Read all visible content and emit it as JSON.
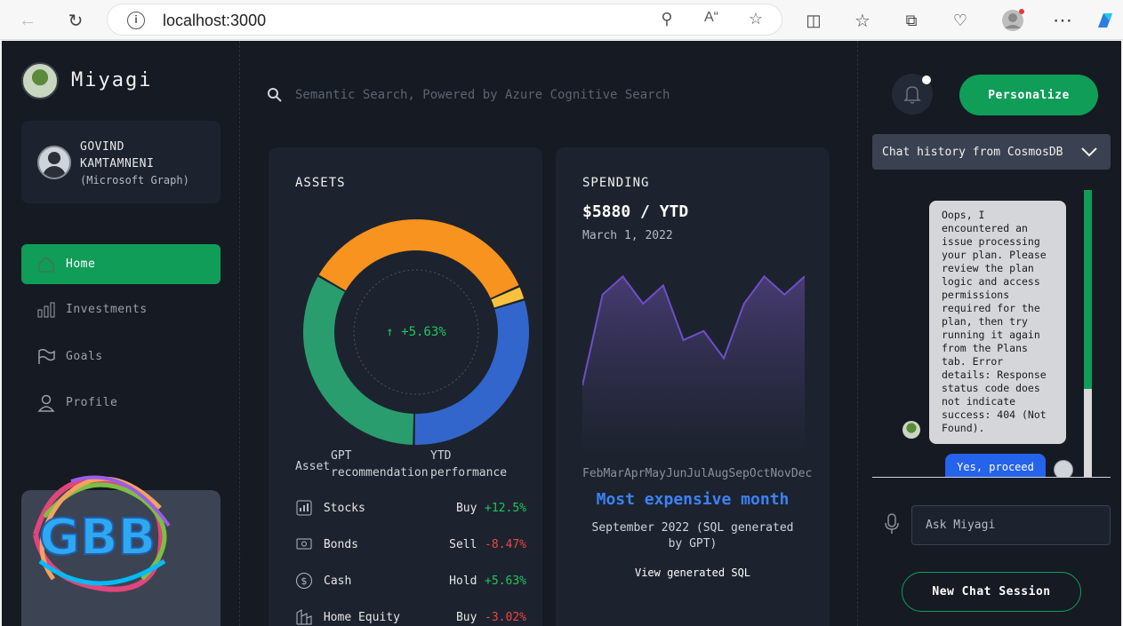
{
  "browser": {
    "url": "localhost:3000"
  },
  "sidebar": {
    "brand": "Miyagi",
    "user": {
      "name": "GOVIND KAMTAMNENI",
      "source": "(Microsoft Graph)"
    },
    "nav": [
      {
        "label": "Home",
        "icon": "home-icon",
        "active": true
      },
      {
        "label": "Investments",
        "icon": "bar-chart-icon",
        "active": false
      },
      {
        "label": "Goals",
        "icon": "flag-icon",
        "active": false
      },
      {
        "label": "Profile",
        "icon": "user-icon",
        "active": false
      }
    ],
    "logo_text": "GBB"
  },
  "main": {
    "search_placeholder": "Semantic Search, Powered by Azure Cognitive Search",
    "assets": {
      "title": "ASSETS",
      "center_label": "↑ +5.63%",
      "columns": [
        "Asset",
        "GPT recommendation",
        "YTD performance"
      ],
      "rows": [
        {
          "name": "Stocks",
          "recommendation": "Buy",
          "performance": "+12.5%",
          "trend": "pos",
          "icon": "stocks-icon"
        },
        {
          "name": "Bonds",
          "recommendation": "Sell",
          "performance": "-8.47%",
          "trend": "neg",
          "icon": "bonds-icon"
        },
        {
          "name": "Cash",
          "recommendation": "Hold",
          "performance": "+5.63%",
          "trend": "pos",
          "icon": "cash-icon"
        },
        {
          "name": "Home Equity",
          "recommendation": "Buy",
          "performance": "-3.02%",
          "trend": "neg",
          "icon": "home-equity-icon"
        }
      ],
      "colors": {
        "orange": "#f7931e",
        "yellow": "#f6c23e",
        "blue": "#3366cc",
        "green": "#2a9d6f"
      }
    },
    "spending": {
      "title": "SPENDING",
      "amount": "$5880 / YTD",
      "date": "March 1, 2022",
      "months": [
        "Feb",
        "Mar",
        "Apr",
        "May",
        "Jun",
        "Jul",
        "Aug",
        "Sep",
        "Oct",
        "Nov",
        "Dec"
      ],
      "most_expensive_label": "Most expensive month",
      "most_expensive_detail": "September 2022 (SQL generated by GPT)",
      "view_sql": "View generated SQL"
    }
  },
  "right": {
    "personalize": "Personalize",
    "chat_history": "Chat history from CosmosDB",
    "bot_message": "Oops, I encountered an issue processing your plan. Please review the plan logic and access permissions required for the plan, then try running it again from the Plans tab. Error details: Response status code does not indicate success: 404 (Not Found).",
    "user_message": "Yes, proceed",
    "ask_placeholder": "Ask Miyagi",
    "new_chat": "New Chat Session"
  },
  "chart_data": [
    {
      "type": "pie",
      "title": "ASSETS",
      "categories": [
        "Stocks",
        "Bonds",
        "Cash",
        "Home Equity"
      ],
      "values": [
        35,
        2,
        30,
        33
      ],
      "colors": [
        "#f7931e",
        "#f6c23e",
        "#3366cc",
        "#2a9d6f"
      ]
    },
    {
      "type": "area",
      "title": "SPENDING",
      "categories": [
        "Feb",
        "Mar",
        "Apr",
        "May",
        "Jun",
        "Jul",
        "Aug",
        "Sep",
        "Oct",
        "Nov",
        "Dec"
      ],
      "values": [
        0.35,
        0.85,
        0.95,
        0.8,
        0.9,
        0.6,
        0.65,
        0.5,
        0.8,
        0.95,
        0.85,
        0.95
      ],
      "color": "#6d4fc7"
    }
  ]
}
